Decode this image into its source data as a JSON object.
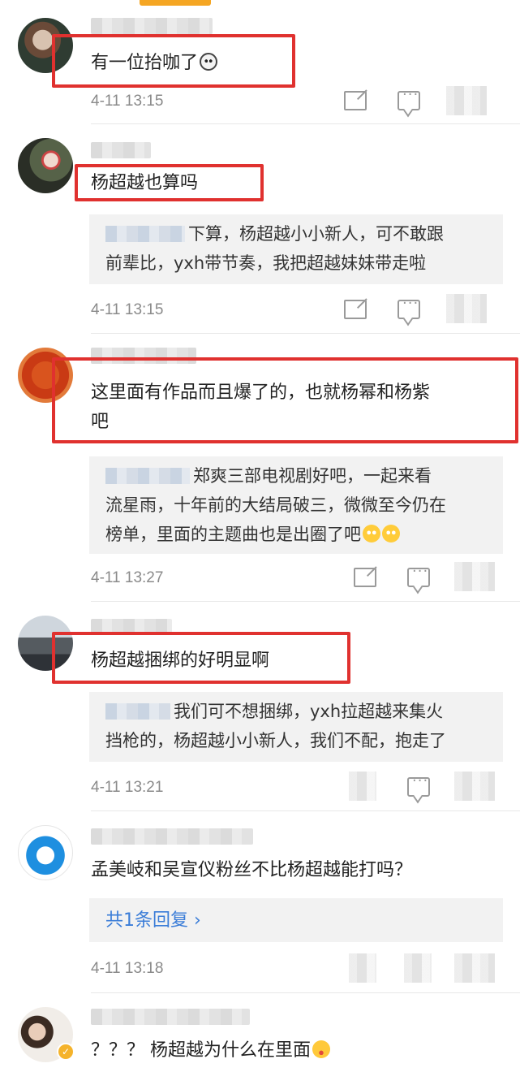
{
  "comments": [
    {
      "text": "有一位抬咖了",
      "emoji": "panda-emoji",
      "time": "4-11 13:15"
    },
    {
      "text": "杨超越也算吗",
      "reply": "下算，杨超越小小新人，可不敢跟",
      "reply_line2": "前辈比，yxh带节奏，我把超越妹妹带走啦",
      "time": "4-11 13:15"
    },
    {
      "text": "这里面有作品而且爆了的，也就杨幂和杨紫",
      "text_line2": "吧",
      "reply": "郑爽三部电视剧好吧，一起来看",
      "reply_line2": "流星雨，十年前的大结局破三，微微至今仍在",
      "reply_line3": "榜单，里面的主题曲也是出圈了吧",
      "time": "4-11 13:27"
    },
    {
      "text": "杨超越捆绑的好明显啊",
      "reply": "我们可不想捆绑，yxh拉超越来集火",
      "reply_line2": "挡枪的，杨超越小小新人，我们不配，抱走了",
      "time": "4-11 13:21"
    },
    {
      "text": "孟美岐和吴宣仪粉丝不比杨超越能打吗？",
      "reply_link": "共1条回复 ",
      "time": "4-11 13:18"
    },
    {
      "text": "？？？ 杨超越为什么在里面"
    }
  ],
  "colors": {
    "highlight": "#e0312f",
    "link": "#3b7dd8",
    "meta": "#8a8a8a",
    "reply_bg": "#f2f2f2"
  }
}
